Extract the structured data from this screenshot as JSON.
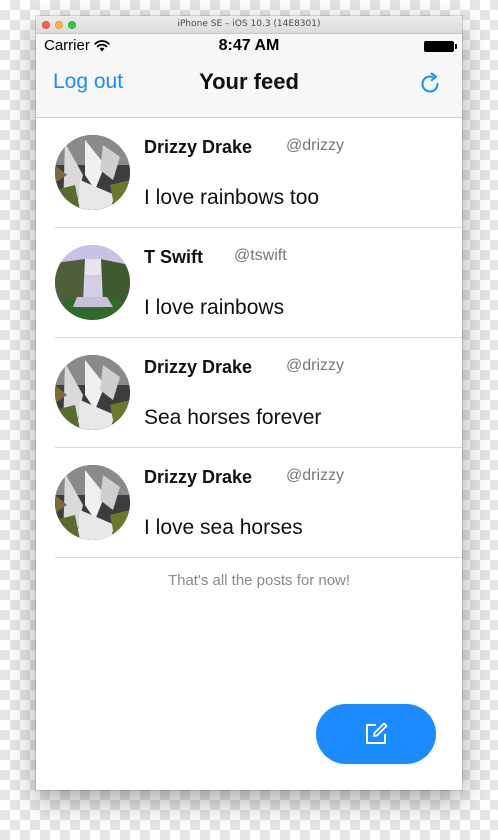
{
  "simulator": {
    "title": "iPhone SE – iOS 10.3 (14E8301)"
  },
  "status_bar": {
    "carrier": "Carrier",
    "time": "8:47 AM"
  },
  "nav": {
    "left_label": "Log out",
    "title": "Your feed",
    "right_icon": "refresh-icon"
  },
  "posts": [
    {
      "name": "Drizzy Drake",
      "handle": "@drizzy",
      "text": "I love rainbows too",
      "avatar": "waterfall-bw"
    },
    {
      "name": "T Swift",
      "handle": "@tswift",
      "text": "I love rainbows",
      "avatar": "waterfall-color"
    },
    {
      "name": "Drizzy Drake",
      "handle": "@drizzy",
      "text": "Sea horses forever",
      "avatar": "waterfall-bw"
    },
    {
      "name": "Drizzy Drake",
      "handle": "@drizzy",
      "text": "I love sea horses",
      "avatar": "waterfall-bw"
    }
  ],
  "footer": {
    "note": "That's all the posts for now!"
  },
  "compose": {
    "icon": "compose-icon"
  },
  "colors": {
    "accent": "#1a8cff",
    "nav_background": "#f7f7f7",
    "secondary_text": "#777777"
  }
}
